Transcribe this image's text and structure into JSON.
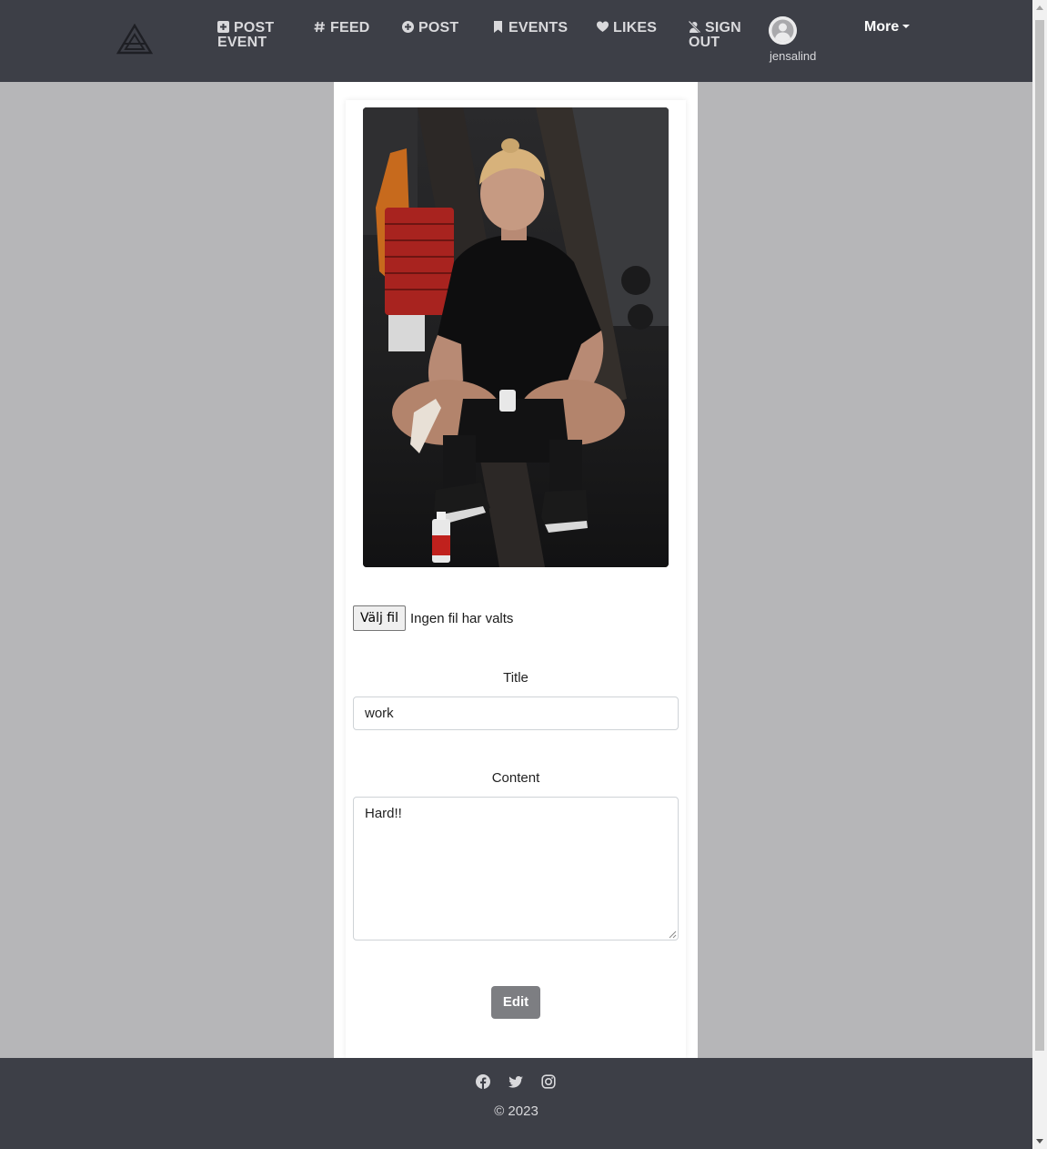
{
  "nav": {
    "items": [
      {
        "label": "POST",
        "label2": "EVENT",
        "icon": "plus-square-icon"
      },
      {
        "label": "FEED",
        "icon": "hashtag-icon"
      },
      {
        "label": "POST",
        "icon": "plus-circle-icon"
      },
      {
        "label": "EVENTS",
        "icon": "bookmark-icon"
      },
      {
        "label": "LIKES",
        "icon": "heart-icon"
      },
      {
        "label": "SIGN",
        "label2": "OUT",
        "icon": "sign-out-icon"
      }
    ],
    "username": "jensalind",
    "more_label": "More"
  },
  "form": {
    "file_button": "Välj fil",
    "file_status": "Ingen fil har valts",
    "title_label": "Title",
    "title_value": "work",
    "content_label": "Content",
    "content_value": "Hard!!",
    "submit_label": "Edit"
  },
  "footer": {
    "social_icons": [
      "facebook-icon",
      "twitter-icon",
      "instagram-icon"
    ],
    "copyright": "© 2023"
  },
  "colors": {
    "navbar_bg": "#3d3f47",
    "page_bg": "#b6b6b8",
    "button_bg": "#7d7e82"
  }
}
